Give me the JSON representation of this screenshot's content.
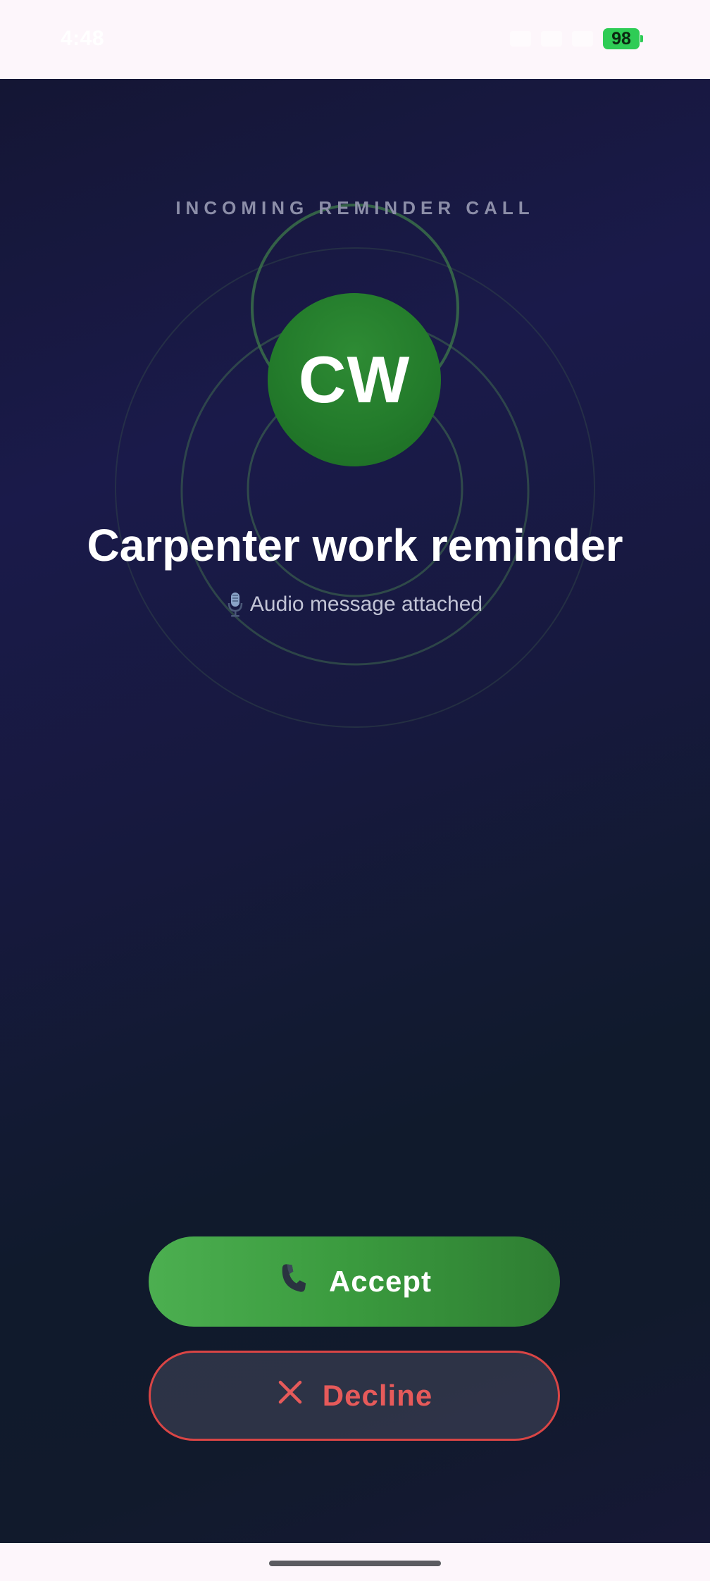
{
  "status_bar": {
    "time": "4:48",
    "battery": "98",
    "battery_color": "#2ecc55"
  },
  "call": {
    "label": "INCOMING REMINDER CALL",
    "avatar_initials": "CW",
    "avatar_color": "#237b2b",
    "title": "Carpenter work reminder",
    "subtitle": "Audio message attached",
    "subtitle_icon": "microphone-icon"
  },
  "actions": {
    "accept_label": "Accept",
    "accept_icon": "phone-icon",
    "accept_color": "#4caf50",
    "decline_label": "Decline",
    "decline_icon": "close-icon",
    "decline_color": "#d94545"
  }
}
